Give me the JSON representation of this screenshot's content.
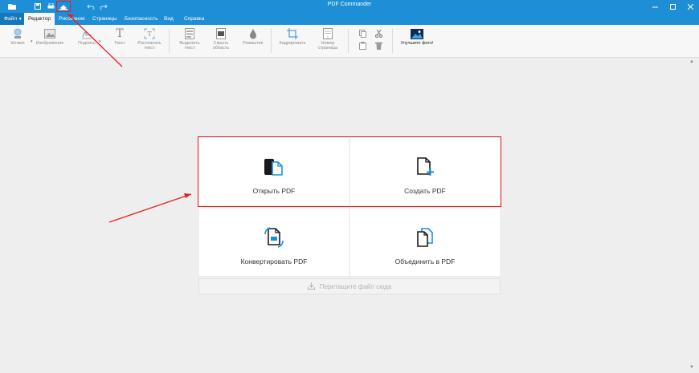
{
  "window": {
    "title": "PDF Commander"
  },
  "menu": {
    "file": "Файл",
    "tabs": [
      "Редактор",
      "Рисование",
      "Страницы",
      "Безопасность",
      "Вид",
      "Справка"
    ]
  },
  "ribbon": {
    "stamp": "Штамп",
    "image": "Изображение",
    "signature": "Подпись",
    "text": "Текст",
    "recognize": "Распознать\nтекст",
    "highlight": "Выделить\nтекст",
    "hide": "Скрыть\nобласть",
    "blur": "Размытие",
    "crop": "Кадрировать",
    "page_number": "Номер\nстраницы",
    "enhance_photo": "Улучшите фото!"
  },
  "start": {
    "open": "Открыть PDF",
    "create": "Создать PDF",
    "convert": "Конвертировать PDF",
    "merge": "Объединить в PDF",
    "drop": "Перетащите файл сюда"
  },
  "colors": {
    "accent": "#1e8fd6",
    "highlight": "#e21f26"
  }
}
